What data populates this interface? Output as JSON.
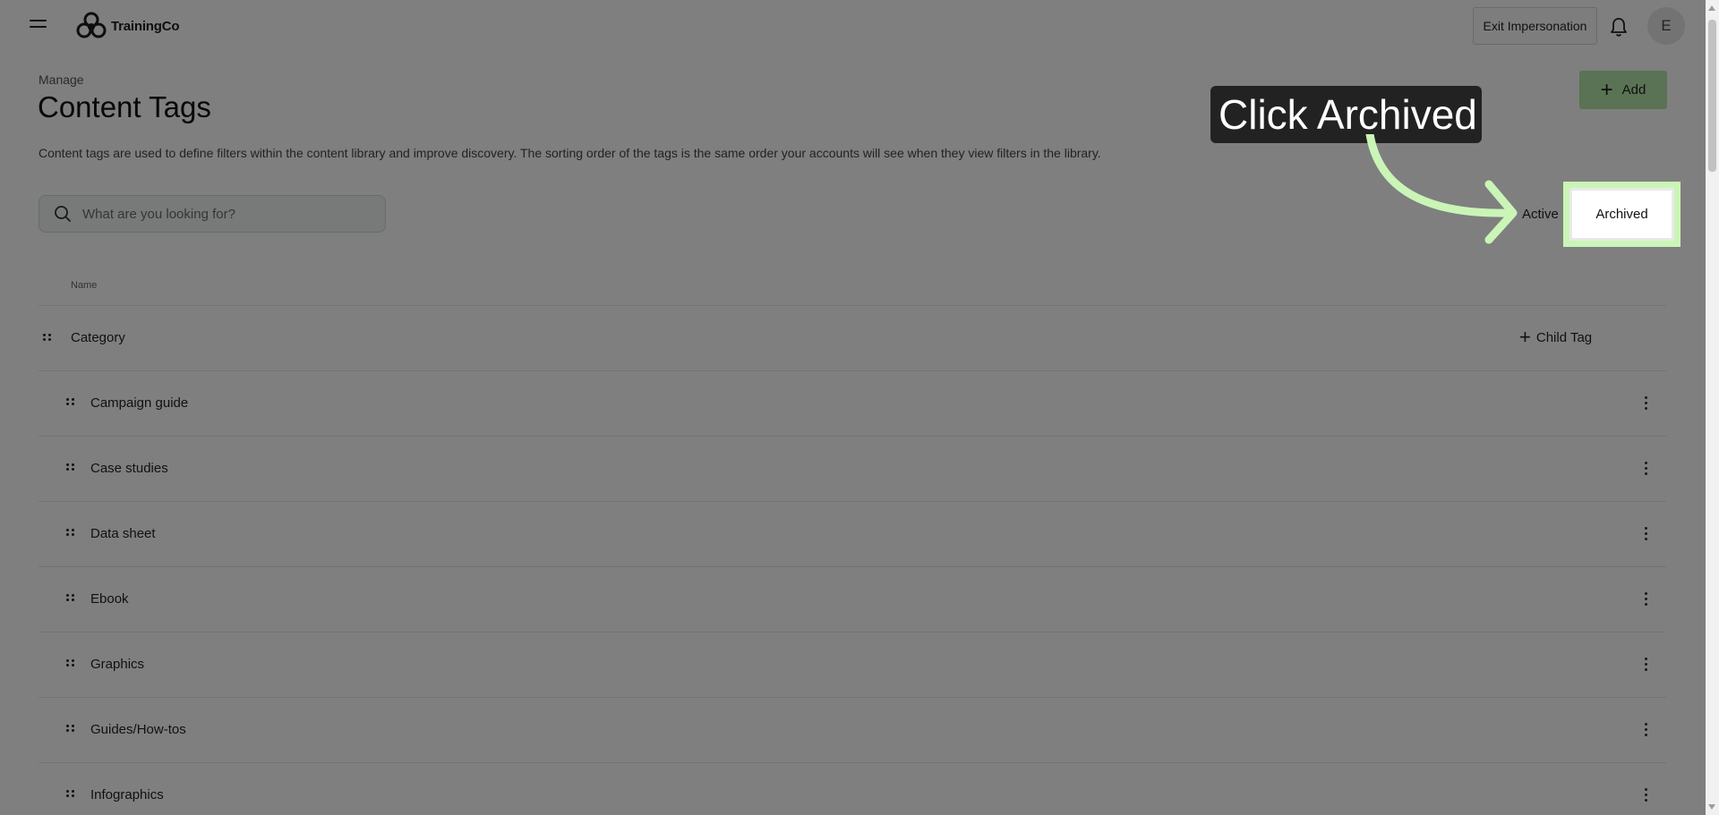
{
  "app": {
    "brand": "TrainingCo"
  },
  "topbar": {
    "exit_label": "Exit Impersonation",
    "avatar_initial": "E"
  },
  "header": {
    "breadcrumb": "Manage",
    "title": "Content Tags",
    "description": "Content tags are used to define filters within the content library and improve discovery. The sorting order of the tags is the same order your accounts will see when they view filters in the library.",
    "add_label": "Add"
  },
  "search": {
    "placeholder": "What are you looking for?"
  },
  "tabs": {
    "active_label": "Active",
    "archived_label": "Archived"
  },
  "table": {
    "column_name": "Name",
    "parent": {
      "label": "Category",
      "child_tag_label": "Child Tag"
    },
    "rows": [
      "Campaign guide",
      "Case studies",
      "Data sheet",
      "Ebook",
      "Graphics",
      "Guides/How-tos",
      "Infographics"
    ]
  },
  "tooltip": {
    "text": "Click Archived"
  },
  "colors": {
    "highlight": "#caf5b7",
    "add_button": "#b4e6a8",
    "tooltip_bg": "#222222"
  },
  "icons": [
    "hamburger-icon",
    "logo-icon",
    "bell-icon",
    "search-icon",
    "plus-icon",
    "drag-handle-icon",
    "kebab-menu-icon",
    "arrow-icon"
  ]
}
